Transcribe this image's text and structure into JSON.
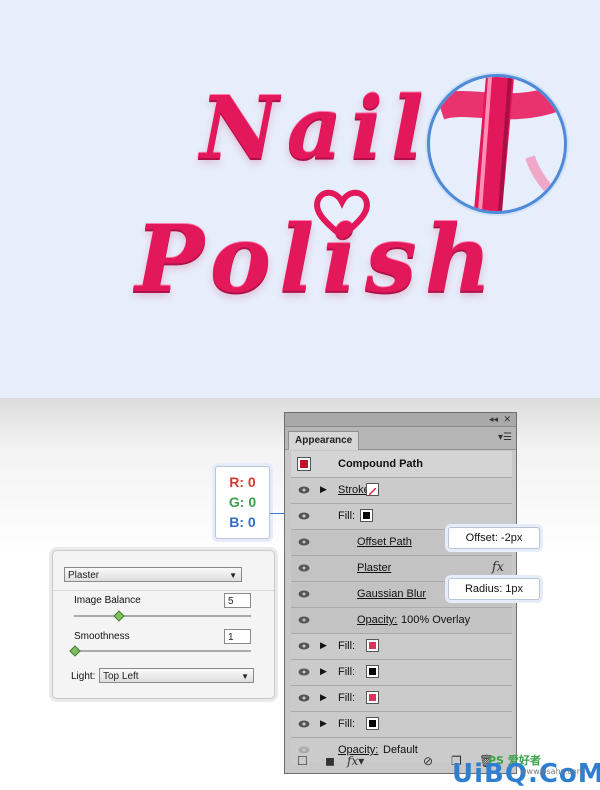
{
  "colors": {
    "accent_pink": "#e2185b",
    "link_blue": "#1f4fb5",
    "swatch_red": "#d8355d",
    "rgb_r": "#d63a2f",
    "rgb_g": "#3aa34a",
    "rgb_b": "#2f6fc4"
  },
  "artwork": {
    "line1": "Nail",
    "line2": "Polish"
  },
  "rgb_callout": {
    "r": "R: 0",
    "g": "G: 0",
    "b": "B: 0"
  },
  "panel": {
    "tab_title": "Appearance",
    "menu_icon": "panel-menu-icon",
    "collapse_label": "◂◂",
    "close_label": "✕",
    "compound_path": "Compound Path",
    "rows": [
      {
        "label": "Stroke:",
        "swatch": "none-slash"
      },
      {
        "label": "Fill:",
        "swatch": "#000000"
      },
      {
        "label": "Offset Path"
      },
      {
        "label": "Plaster"
      },
      {
        "label": "Gaussian Blur"
      },
      {
        "label": "Opacity:",
        "value": "100% Overlay"
      },
      {
        "label": "Fill:",
        "swatch": "#d8355d"
      },
      {
        "label": "Fill:",
        "swatch": "#000000"
      },
      {
        "label": "Fill:",
        "swatch": "#d8355d"
      },
      {
        "label": "Fill:",
        "swatch": "#000000"
      }
    ],
    "default_opacity_label": "Opacity:",
    "default_opacity_value": "Default",
    "fx_label": "fx"
  },
  "callouts": {
    "offset": "Offset: -2px",
    "radius": "Radius: 1px"
  },
  "plaster": {
    "preset": "Plaster",
    "image_balance_label": "Image Balance",
    "image_balance_value": "5",
    "image_balance_level": 0.25,
    "smoothness_label": "Smoothness",
    "smoothness_value": "1",
    "smoothness_level": 0.0,
    "light_label": "Light:",
    "light_value": "Top Left"
  },
  "watermark": {
    "text": "UiBQ.CoM",
    "sub": "PS 爱好者",
    "sub2": "www.psahz.com"
  }
}
